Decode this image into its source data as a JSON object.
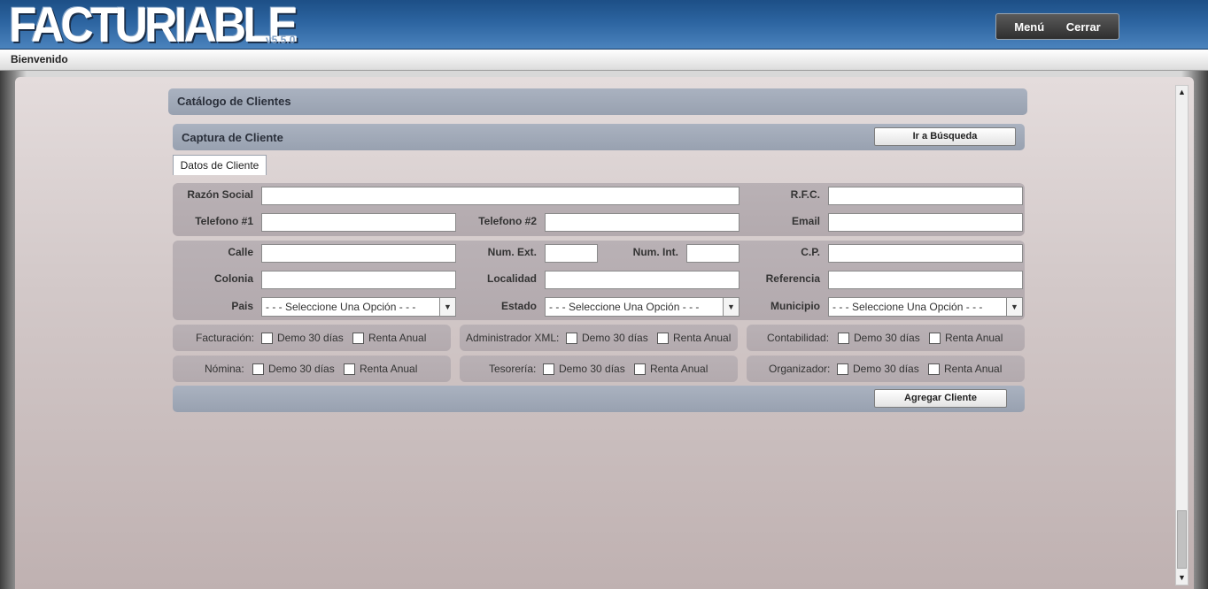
{
  "header": {
    "logo": "FACTURIABLE",
    "version": "v5.5.0",
    "menu_label": "Menú",
    "close_label": "Cerrar"
  },
  "subbar": {
    "welcome": "Bienvenido"
  },
  "catalog_title": "Catálogo de Clientes",
  "capture": {
    "title": "Captura de Cliente",
    "search_button": "Ir a Búsqueda"
  },
  "tab_label": "Datos de Cliente",
  "fields": {
    "razon_social": {
      "label": "Razón Social",
      "value": ""
    },
    "rfc": {
      "label": "R.F.C.",
      "value": ""
    },
    "telefono1": {
      "label": "Telefono #1",
      "value": ""
    },
    "telefono2": {
      "label": "Telefono #2",
      "value": ""
    },
    "email": {
      "label": "Email",
      "value": ""
    },
    "calle": {
      "label": "Calle",
      "value": ""
    },
    "num_ext": {
      "label": "Num. Ext.",
      "value": ""
    },
    "num_int": {
      "label": "Num. Int.",
      "value": ""
    },
    "cp": {
      "label": "C.P.",
      "value": ""
    },
    "colonia": {
      "label": "Colonia",
      "value": ""
    },
    "localidad": {
      "label": "Localidad",
      "value": ""
    },
    "referencia": {
      "label": "Referencia",
      "value": ""
    },
    "pais": {
      "label": "Pais",
      "selected": "- - - Seleccione Una Opción - - -"
    },
    "estado": {
      "label": "Estado",
      "selected": "- - - Seleccione Una Opción - - -"
    },
    "municipio": {
      "label": "Municipio",
      "selected": "- - - Seleccione Una Opción - - -"
    }
  },
  "services": {
    "demo_label": "Demo 30 días",
    "renta_label": "Renta Anual",
    "facturacion": "Facturación:",
    "administrador_xml": "Administrador XML:",
    "contabilidad": "Contabilidad:",
    "nomina": "Nómina:",
    "tesoreria": "Tesorería:",
    "organizador": "Organizador:"
  },
  "add_button": "Agregar Cliente"
}
